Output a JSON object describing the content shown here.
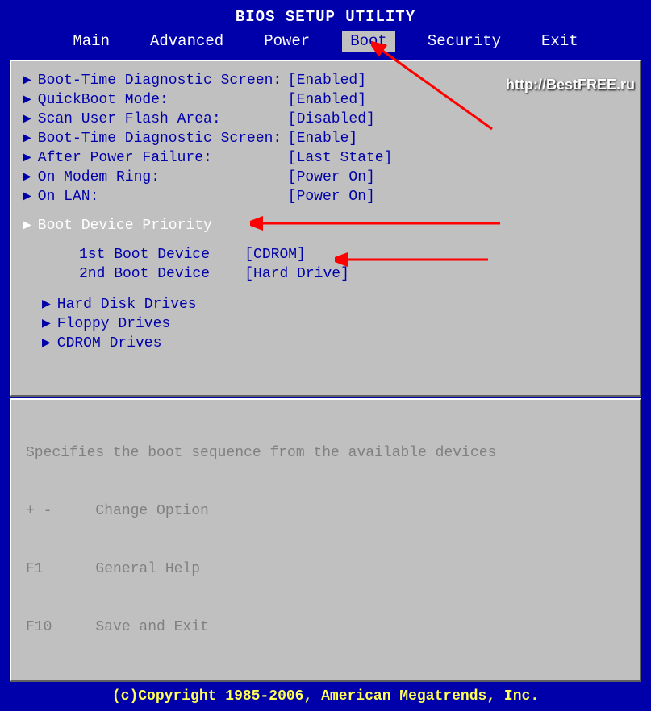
{
  "title": "BIOS SETUP UTILITY",
  "tabs": [
    "Main",
    "Advanced",
    "Power",
    "Boot",
    "Security",
    "Exit"
  ],
  "active_tab": "Boot",
  "options": [
    {
      "label": "Boot-Time Diagnostic Screen:",
      "value": "[Enabled]"
    },
    {
      "label": "QuickBoot Mode:",
      "value": "[Enabled]"
    },
    {
      "label": "Scan User Flash Area:",
      "value": "[Disabled]"
    },
    {
      "label": "Boot-Time Diagnostic Screen:",
      "value": "[Enable]"
    },
    {
      "label": "After Power Failure:",
      "value": "[Last State]"
    },
    {
      "label": "On Modem Ring:",
      "value": "[Power On]"
    },
    {
      "label": "On LAN:",
      "value": "[Power On]"
    }
  ],
  "priority_label": "Boot Device Priority",
  "boot_devices": [
    {
      "label": "1st Boot Device",
      "value": "[CDROM]"
    },
    {
      "label": "2nd Boot Device",
      "value": "[Hard Drive]"
    }
  ],
  "drives": [
    "Hard Disk Drives",
    "Floppy Drives",
    "CDROM Drives"
  ],
  "help": {
    "line1": "Specifies the boot sequence from the available devices",
    "line2": "+ -     Change Option",
    "line3": "F1      General Help",
    "line4": "F10     Save and Exit"
  },
  "footer": "(c)Copyright 1985-2006, American Megatrends, Inc.",
  "watermark": "http://BestFREE.ru"
}
